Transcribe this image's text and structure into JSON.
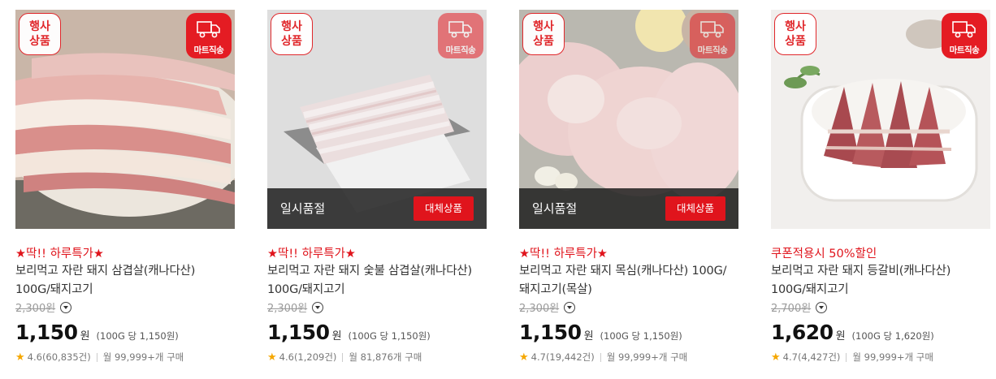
{
  "products": [
    {
      "event_badge": [
        "행사",
        "상품"
      ],
      "delivery_label": "마트직송",
      "promo": "★딱!! 하루특가★",
      "name_line1": "보리먹고 자란 돼지 삼겹살(캐나다산)",
      "name_line2": "100G/돼지고기",
      "original_price": "2,300원",
      "price": "1,150",
      "currency": "원",
      "unit_price": "(100G 당 1,150원)",
      "rating": "4.6(60,835건)",
      "purchases": "월 99,999+개 구매"
    },
    {
      "event_badge": [
        "행사",
        "상품"
      ],
      "delivery_label": "마트직송",
      "soldout_text": "일시품절",
      "alt_button": "대체상품",
      "promo": "★딱!! 하루특가★",
      "name_line1": "보리먹고 자란 돼지 숯불 삼겹살(캐나다산)",
      "name_line2": "100G/돼지고기",
      "original_price": "2,300원",
      "price": "1,150",
      "currency": "원",
      "unit_price": "(100G 당 1,150원)",
      "rating": "4.6(1,209건)",
      "purchases": "월 81,876개 구매"
    },
    {
      "event_badge": [
        "행사",
        "상품"
      ],
      "delivery_label": "마트직송",
      "soldout_text": "일시품절",
      "alt_button": "대체상품",
      "promo": "★딱!! 하루특가★",
      "name_line1": "보리먹고 자란 돼지 목심(캐나다산) 100G/",
      "name_line2": "돼지고기(목살)",
      "original_price": "2,300원",
      "price": "1,150",
      "currency": "원",
      "unit_price": "(100G 당 1,150원)",
      "rating": "4.7(19,442건)",
      "purchases": "월 99,999+개 구매"
    },
    {
      "event_badge": [
        "행사",
        "상품"
      ],
      "delivery_label": "마트직송",
      "promo": "쿠폰적용시 50%할인",
      "name_line1": "보리먹고 자란 돼지 등갈비(캐나다산)",
      "name_line2": "100G/돼지고기",
      "original_price": "2,700원",
      "price": "1,620",
      "currency": "원",
      "unit_price": "(100G 당 1,620원)",
      "rating": "4.7(4,427건)",
      "purchases": "월 99,999+개 구매"
    }
  ],
  "colors": {
    "accent": "#e41c23",
    "promo": "#e0141c",
    "star": "#f5a700"
  }
}
